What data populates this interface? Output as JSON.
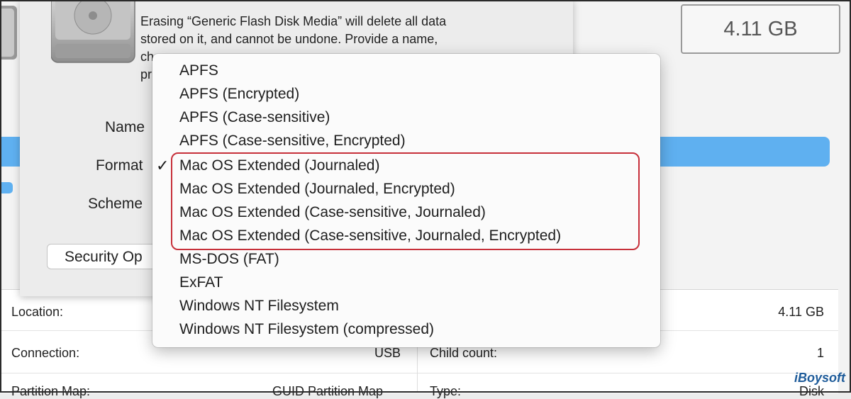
{
  "dialog": {
    "description_lines": [
      "Erasing “Generic Flash Disk Media” will delete all data",
      "stored on it, and cannot be undone. Provide a name,",
      "ch",
      "pr"
    ],
    "labels": {
      "name": "Name",
      "format": "Format",
      "scheme": "Scheme"
    },
    "security_button": "Security Op"
  },
  "capacity": "4.11 GB",
  "format_menu": {
    "items": [
      "APFS",
      "APFS (Encrypted)",
      "APFS (Case-sensitive)",
      "APFS (Case-sensitive, Encrypted)",
      "Mac OS Extended (Journaled)",
      "Mac OS Extended (Journaled, Encrypted)",
      "Mac OS Extended (Case-sensitive, Journaled)",
      "Mac OS Extended (Case-sensitive, Journaled, Encrypted)",
      "MS-DOS (FAT)",
      "ExFAT",
      "Windows NT Filesystem",
      "Windows NT Filesystem (compressed)"
    ],
    "selected": "Mac OS Extended (Journaled)",
    "checkmark": "✓"
  },
  "info": {
    "location_label": "Location:",
    "capacity_value": "4.11 GB",
    "connection_label": "Connection:",
    "connection_value": "USB",
    "child_count_label": "Child count:",
    "child_count_value": "1",
    "partition_map_label": "Partition Map:",
    "partition_map_value": "GUID Partition Map",
    "type_label": "Type:",
    "type_value": "Disk"
  },
  "watermark": "iBoysoft"
}
